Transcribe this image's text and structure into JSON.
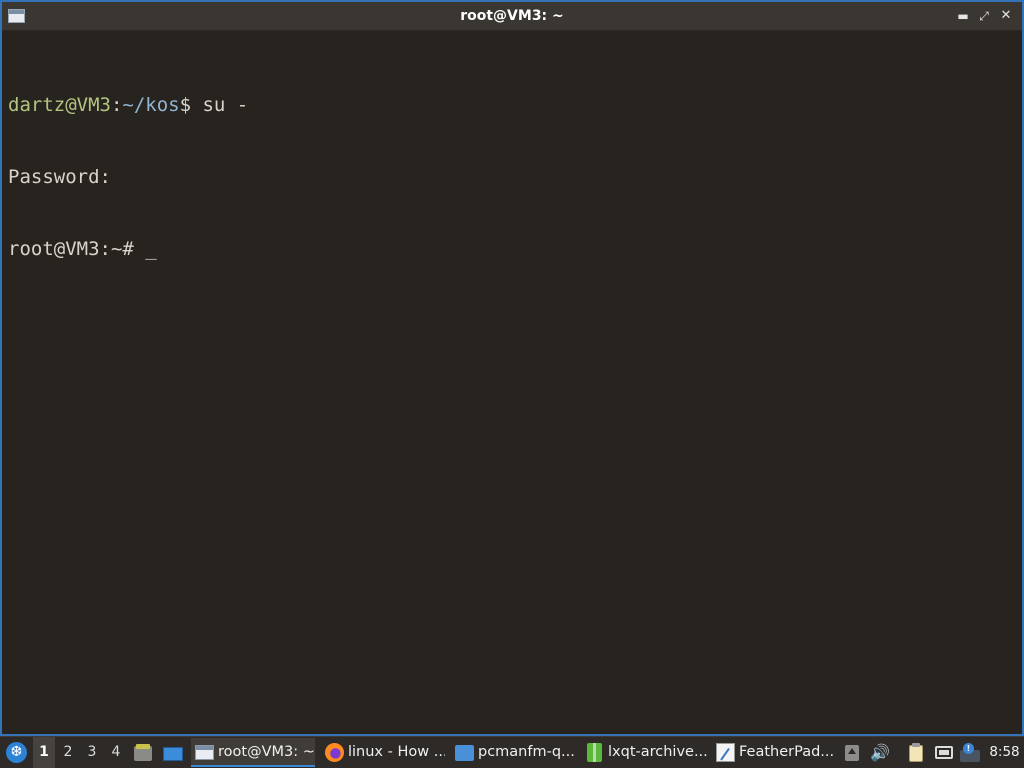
{
  "window": {
    "title": "root@VM3: ~"
  },
  "terminal": {
    "lines": [
      {
        "user_host": "dartz@VM3",
        "sep": ":",
        "path": "~/kos",
        "rest": "$ su -"
      },
      {
        "text": "Password:"
      },
      {
        "text": "root@VM3:~# ",
        "cursor": "_"
      }
    ]
  },
  "taskbar": {
    "start_icon": "lxqt-start-icon",
    "workspaces": [
      "1",
      "2",
      "3",
      "4"
    ],
    "active_workspace": "1",
    "quicklaunch": [
      {
        "icon": "file-manager-icon"
      },
      {
        "icon": "show-desktop-icon"
      }
    ],
    "tasks": [
      {
        "label": "root@VM3: ~",
        "icon": "terminal-icon",
        "active": true
      },
      {
        "label": "linux - How ...",
        "icon": "firefox-icon",
        "active": false
      },
      {
        "label": "pcmanfm-q...",
        "icon": "folder-icon",
        "active": false
      },
      {
        "label": "lxqt-archive...",
        "icon": "archive-icon",
        "active": false
      },
      {
        "label": "FeatherPad...",
        "icon": "featherpad-icon",
        "active": false
      }
    ],
    "tray": [
      "tray-expand-icon",
      "volume-icon",
      "clipboard-icon",
      "network-icon",
      "updates-icon"
    ],
    "clock": "8:58"
  },
  "colors": {
    "terminal_bg": "#272420",
    "prompt_user": "#b3c47e",
    "prompt_path": "#93b4d1",
    "accent": "#3a86d4"
  }
}
